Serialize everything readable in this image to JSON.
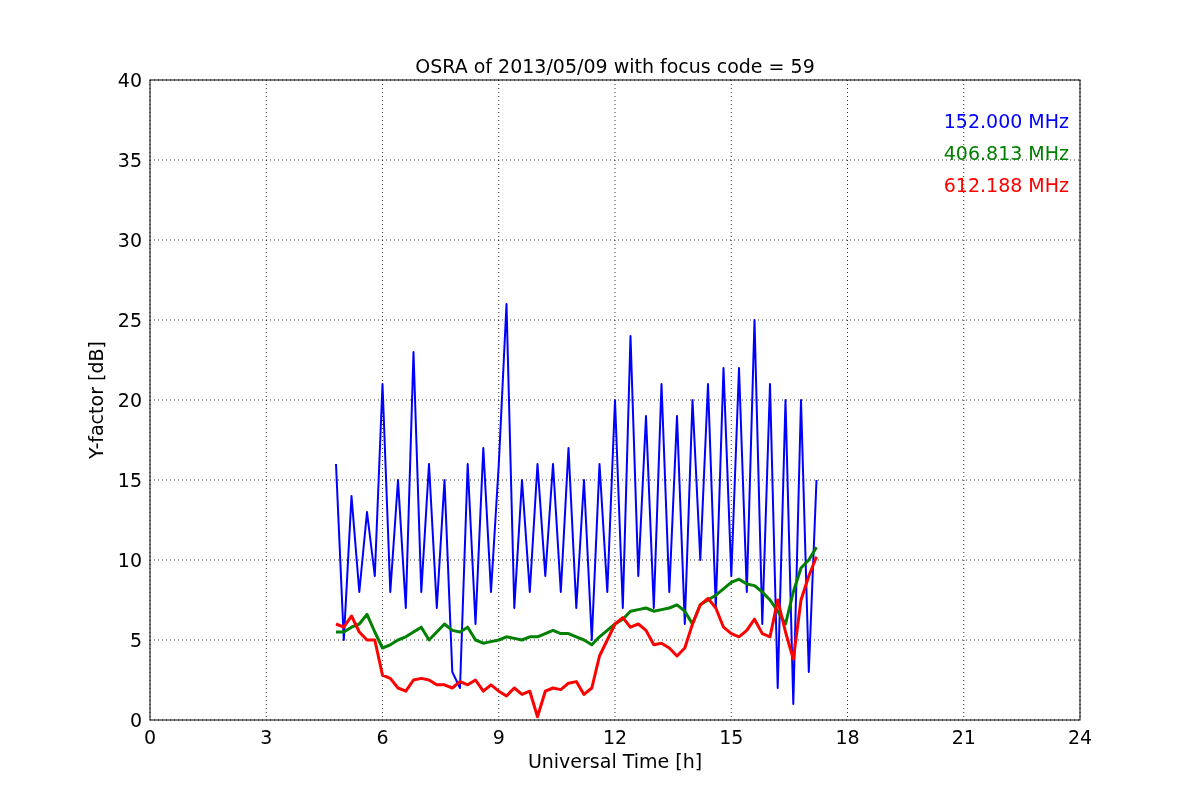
{
  "figure": {
    "chart_data": {
      "type": "line",
      "title": "OSRA of 2013/05/09 with focus code = 59",
      "xlabel": "Universal Time [h]",
      "ylabel": "Y-factor [dB]",
      "xlim": [
        0,
        24
      ],
      "ylim": [
        0,
        40
      ],
      "grid": true,
      "xticks": [
        0,
        3,
        6,
        9,
        12,
        15,
        18,
        21,
        24
      ],
      "yticks": [
        0,
        5,
        10,
        15,
        20,
        25,
        30,
        35,
        40
      ],
      "x": [
        4.8,
        5.0,
        5.2,
        5.4,
        5.6,
        5.8,
        6.0,
        6.2,
        6.4,
        6.6,
        6.8,
        7.0,
        7.2,
        7.4,
        7.6,
        7.8,
        8.0,
        8.2,
        8.4,
        8.6,
        8.8,
        9.0,
        9.2,
        9.4,
        9.6,
        9.8,
        10.0,
        10.2,
        10.4,
        10.6,
        10.8,
        11.0,
        11.2,
        11.4,
        11.6,
        11.8,
        12.0,
        12.2,
        12.4,
        12.6,
        12.8,
        13.0,
        13.2,
        13.4,
        13.6,
        13.8,
        14.0,
        14.2,
        14.4,
        14.6,
        14.8,
        15.0,
        15.2,
        15.4,
        15.6,
        15.8,
        16.0,
        16.2,
        16.4,
        16.6,
        16.8,
        17.0,
        17.2
      ],
      "series": [
        {
          "name": "152.000 MHz",
          "color": "#0000ff",
          "values": [
            16,
            5,
            14,
            8,
            13,
            9,
            21,
            8,
            15,
            7,
            23,
            8,
            16,
            7,
            15,
            3,
            2,
            16,
            6,
            17,
            8,
            16,
            26,
            7,
            15,
            8,
            16,
            9,
            16,
            8,
            17,
            7,
            15,
            5,
            16,
            8,
            20,
            7,
            24,
            9,
            19,
            7,
            21,
            8,
            19,
            6,
            20,
            10,
            21,
            7,
            22,
            9,
            22,
            8,
            25,
            6,
            21,
            2,
            20,
            1,
            20,
            3,
            15
          ]
        },
        {
          "name": "406.813 MHz",
          "color": "#008000",
          "values": [
            5.5,
            5.5,
            5.8,
            6.0,
            6.6,
            5.5,
            4.5,
            4.7,
            5.0,
            5.2,
            5.5,
            5.8,
            5.0,
            5.5,
            6.0,
            5.6,
            5.5,
            5.8,
            5.0,
            4.8,
            4.9,
            5.0,
            5.2,
            5.1,
            5.0,
            5.2,
            5.2,
            5.4,
            5.6,
            5.4,
            5.4,
            5.2,
            5.0,
            4.7,
            5.2,
            5.6,
            6.0,
            6.3,
            6.8,
            6.9,
            7.0,
            6.8,
            6.9,
            7.0,
            7.2,
            6.8,
            6.0,
            7.2,
            7.5,
            7.8,
            8.2,
            8.6,
            8.8,
            8.5,
            8.4,
            8.0,
            7.5,
            6.8,
            6.0,
            8.0,
            9.5,
            10.0,
            10.8
          ]
        },
        {
          "name": "612.188 MHz",
          "color": "#ff0000",
          "values": [
            6.0,
            5.8,
            6.5,
            5.5,
            5.0,
            5.0,
            2.8,
            2.6,
            2.0,
            1.8,
            2.5,
            2.6,
            2.5,
            2.2,
            2.2,
            2.0,
            2.4,
            2.2,
            2.5,
            1.8,
            2.2,
            1.8,
            1.5,
            2.0,
            1.6,
            1.8,
            0.2,
            1.8,
            2.0,
            1.9,
            2.3,
            2.4,
            1.6,
            2.0,
            4.0,
            5.0,
            6.0,
            6.4,
            5.8,
            6.0,
            5.6,
            4.7,
            4.8,
            4.5,
            4.0,
            4.5,
            6.0,
            7.2,
            7.6,
            7.0,
            5.8,
            5.4,
            5.2,
            5.6,
            6.3,
            5.4,
            5.2,
            7.5,
            5.5,
            3.8,
            7.5,
            9.0,
            10.2
          ]
        }
      ]
    }
  }
}
